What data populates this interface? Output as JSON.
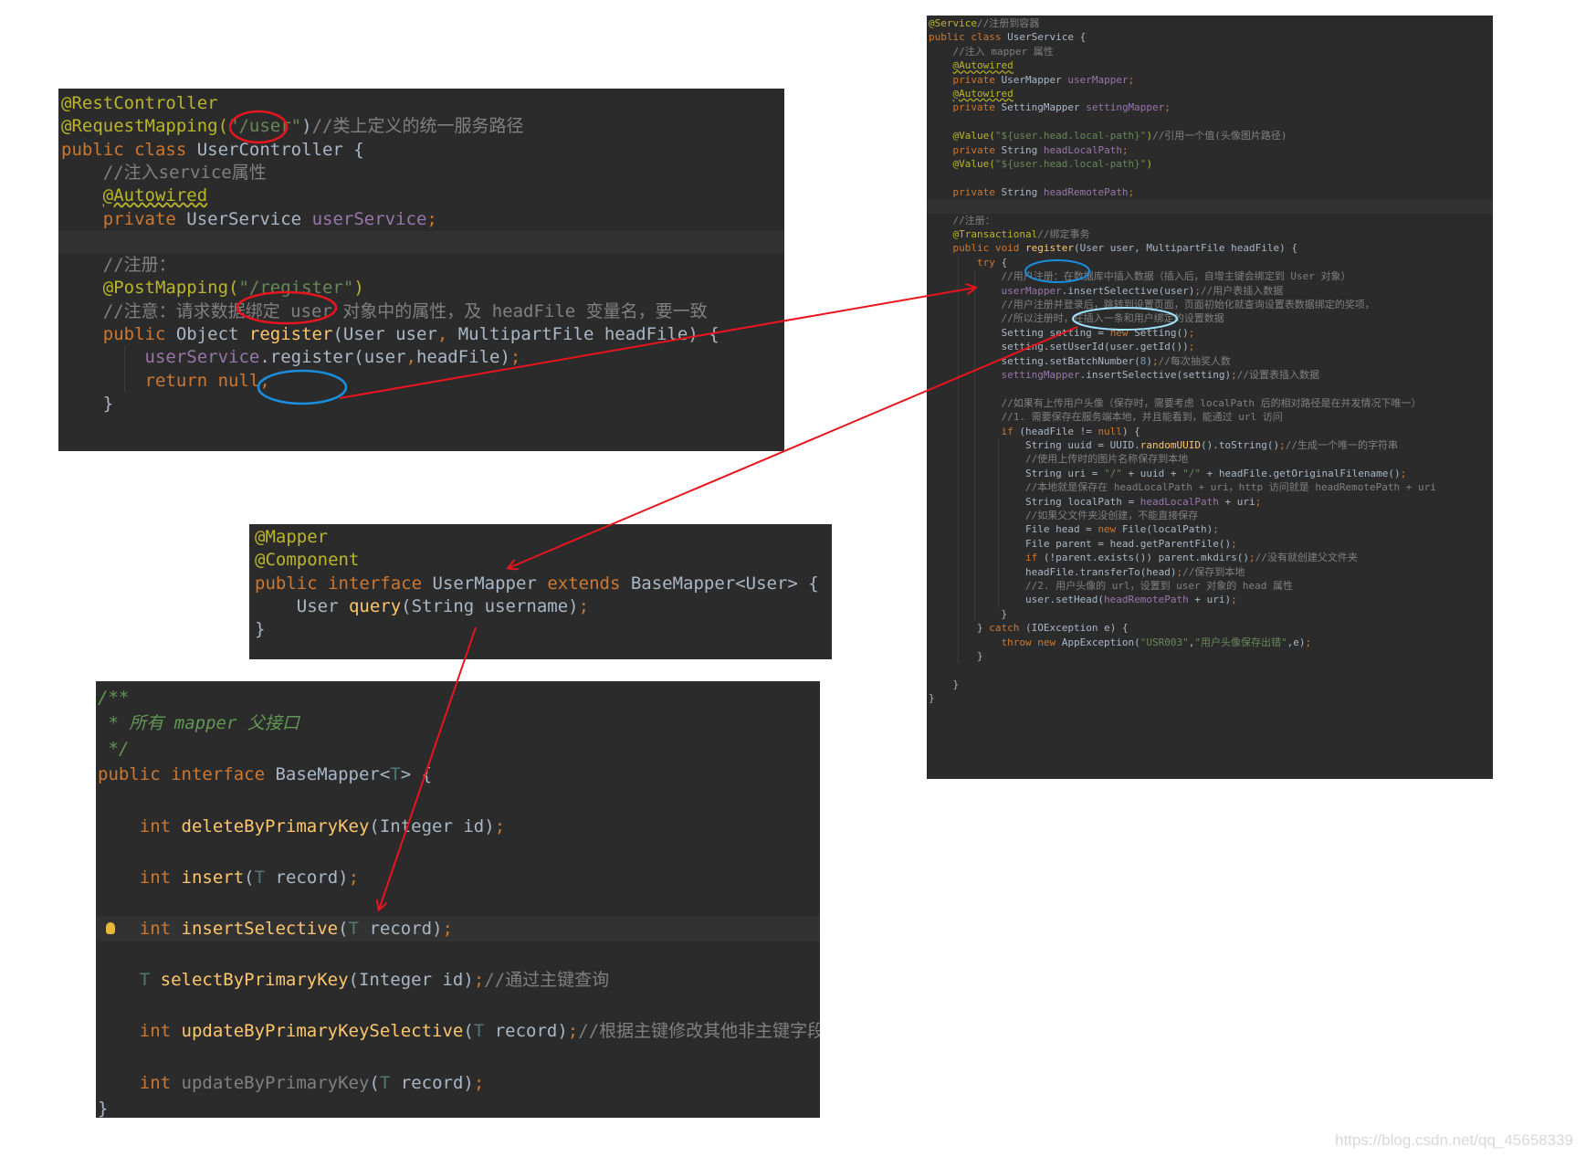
{
  "controller": {
    "lines": [
      [
        [
          "ann",
          "@RestController"
        ]
      ],
      [
        [
          "ann",
          "@RequestMapping("
        ],
        [
          "str",
          "\"/user\""
        ],
        [
          "tx",
          ")"
        ],
        [
          "cm",
          "//类上定义的统一服务路径"
        ]
      ],
      [
        [
          "kw",
          "public class "
        ],
        [
          "tx",
          "UserController {"
        ]
      ],
      [
        [
          "cm",
          "    //注入service属性"
        ]
      ],
      [
        [
          "tx",
          "    "
        ],
        [
          "ann ul",
          "@Autowired"
        ]
      ],
      [
        [
          "kw",
          "    private "
        ],
        [
          "tx",
          "UserService "
        ],
        [
          "fld",
          "userService"
        ],
        [
          "kw",
          ";"
        ]
      ],
      [
        [
          "tx",
          " "
        ]
      ],
      [
        [
          "cm",
          "    //注册："
        ]
      ],
      [
        [
          "ann",
          "    @PostMapping("
        ],
        [
          "str",
          "\"/register\""
        ],
        [
          "ann",
          ")"
        ]
      ],
      [
        [
          "cm",
          "    //注意：请求数据绑定 user 对象中的属性，及 headFile 变量名，要一致"
        ]
      ],
      [
        [
          "kw",
          "    public "
        ],
        [
          "tx",
          "Object "
        ],
        [
          "fn",
          "register"
        ],
        [
          "tx",
          "(User user"
        ],
        [
          "kw",
          ", "
        ],
        [
          "tx",
          "MultipartFile headFile) {"
        ]
      ],
      [
        [
          "fld",
          "        userService"
        ],
        [
          "tx",
          "."
        ],
        [
          "tx",
          "register(user"
        ],
        [
          "kw",
          ","
        ],
        [
          "tx",
          "headFile)"
        ],
        [
          "kw",
          ";"
        ]
      ],
      [
        [
          "kw",
          "        return null;"
        ]
      ],
      [
        [
          "tx",
          "    }"
        ]
      ]
    ]
  },
  "mapper": {
    "lines": [
      [
        [
          "ann",
          "@Mapper"
        ]
      ],
      [
        [
          "ann",
          "@Component"
        ]
      ],
      [
        [
          "kw",
          "public interface "
        ],
        [
          "tx",
          "UserMapper "
        ],
        [
          "kw",
          "extends "
        ],
        [
          "tx",
          "BaseMapper<User> {"
        ]
      ],
      [
        [
          "tx",
          "    User "
        ],
        [
          "fn",
          "query"
        ],
        [
          "tx",
          "(String username)"
        ],
        [
          "kw",
          ";"
        ]
      ],
      [
        [
          "tx",
          "}"
        ]
      ]
    ]
  },
  "basemapper": {
    "lines": [
      [
        [
          "doc",
          "/**"
        ]
      ],
      [
        [
          "doc",
          " * 所有 mapper 父接口"
        ]
      ],
      [
        [
          "doc",
          " */"
        ]
      ],
      [
        [
          "kw",
          "public interface "
        ],
        [
          "tx",
          "BaseMapper<"
        ],
        [
          "tp",
          "T"
        ],
        [
          "tx",
          "> {"
        ]
      ],
      [
        [
          "tx",
          " "
        ]
      ],
      [
        [
          "kw",
          "    int "
        ],
        [
          "fn",
          "deleteByPrimaryKey"
        ],
        [
          "tx",
          "(Integer id)"
        ],
        [
          "kw",
          ";"
        ]
      ],
      [
        [
          "tx",
          " "
        ]
      ],
      [
        [
          "kw",
          "    int "
        ],
        [
          "fn",
          "insert"
        ],
        [
          "tx",
          "("
        ],
        [
          "tp",
          "T "
        ],
        [
          "tx",
          "record)"
        ],
        [
          "kw",
          ";"
        ]
      ],
      [
        [
          "tx",
          " "
        ]
      ],
      [
        [
          "kw",
          "    int "
        ],
        [
          "fn",
          "insertSelective"
        ],
        [
          "tx",
          "("
        ],
        [
          "tp",
          "T "
        ],
        [
          "tx",
          "record)"
        ],
        [
          "kw",
          ";"
        ]
      ],
      [
        [
          "tx",
          " "
        ]
      ],
      [
        [
          "tp",
          "    T "
        ],
        [
          "fn",
          "selectByPrimaryKey"
        ],
        [
          "tx",
          "(Integer id)"
        ],
        [
          "kw",
          ";"
        ],
        [
          "cm",
          "//通过主键查询"
        ]
      ],
      [
        [
          "tx",
          " "
        ]
      ],
      [
        [
          "kw",
          "    int "
        ],
        [
          "fn",
          "updateByPrimaryKeySelective"
        ],
        [
          "tx",
          "("
        ],
        [
          "tp",
          "T "
        ],
        [
          "tx",
          "record)"
        ],
        [
          "kw",
          ";"
        ],
        [
          "cm",
          "//根据主键修改其他非主键字段"
        ]
      ],
      [
        [
          "tx",
          " "
        ]
      ],
      [
        [
          "kw",
          "    int "
        ],
        [
          "cm",
          "updateByPrimaryKey"
        ],
        [
          "tx",
          "("
        ],
        [
          "tp",
          "T "
        ],
        [
          "tx",
          "record)"
        ],
        [
          "kw",
          ";"
        ]
      ],
      [
        [
          "tx",
          "}"
        ]
      ]
    ]
  },
  "service": {
    "lines": [
      [
        [
          "ann",
          "@Service"
        ],
        [
          "cm",
          "//注册到容器"
        ]
      ],
      [
        [
          "kw",
          "public class "
        ],
        [
          "tx",
          "UserService {"
        ]
      ],
      [
        [
          "cm",
          "    //注入 mapper 属性"
        ]
      ],
      [
        [
          "tx",
          "    "
        ],
        [
          "ann ul",
          "@Autowired"
        ]
      ],
      [
        [
          "kw",
          "    private "
        ],
        [
          "tx",
          "UserMapper "
        ],
        [
          "fld",
          "userMapper"
        ],
        [
          "kw",
          ";"
        ]
      ],
      [
        [
          "tx",
          "    "
        ],
        [
          "ann ul",
          "@Autowired"
        ]
      ],
      [
        [
          "kw",
          "    private "
        ],
        [
          "tx",
          "SettingMapper "
        ],
        [
          "fld",
          "settingMapper"
        ],
        [
          "kw",
          ";"
        ]
      ],
      [
        [
          "tx",
          " "
        ]
      ],
      [
        [
          "ann",
          "    @Value("
        ],
        [
          "str",
          "\"${user.head.local-path}\""
        ],
        [
          "ann",
          ")"
        ],
        [
          "cm",
          "//引用一个值(头像图片路径)"
        ]
      ],
      [
        [
          "kw",
          "    private "
        ],
        [
          "tx",
          "String "
        ],
        [
          "fld",
          "headLocalPath"
        ],
        [
          "kw",
          ";"
        ]
      ],
      [
        [
          "ann",
          "    @Value("
        ],
        [
          "str",
          "\"${user.head.local-path}\""
        ],
        [
          "ann",
          ")"
        ]
      ],
      [
        [
          "tx",
          " "
        ]
      ],
      [
        [
          "kw",
          "    private "
        ],
        [
          "tx",
          "String "
        ],
        [
          "fld",
          "headRemotePath"
        ],
        [
          "kw",
          ";"
        ]
      ],
      [
        [
          "tx",
          " "
        ]
      ],
      [
        [
          "cm",
          "    //注册："
        ]
      ],
      [
        [
          "ann",
          "    @Transactional"
        ],
        [
          "cm",
          "//绑定事务"
        ]
      ],
      [
        [
          "kw",
          "    public void "
        ],
        [
          "fn",
          "register"
        ],
        [
          "tx",
          "(User user, MultipartFile headFile) {"
        ]
      ],
      [
        [
          "kw",
          "        try "
        ],
        [
          "tx",
          "{"
        ]
      ],
      [
        [
          "cm",
          "            //用户注册：在数据库中插入数据（插入后，自增主键会绑定到 User 对象）"
        ]
      ],
      [
        [
          "fld",
          "            userMapper"
        ],
        [
          "tx",
          ".insertSelective(user)"
        ],
        [
          "kw",
          ";"
        ],
        [
          "cm",
          "//用户表插入数据"
        ]
      ],
      [
        [
          "cm",
          "            //用户注册并登录后，跳转到设置页面，页面初始化就查询设置表数据绑定的奖项，"
        ]
      ],
      [
        [
          "cm",
          "            //所以注册时，在插入一条和用户绑定的设置数据"
        ]
      ],
      [
        [
          "tx",
          "            Setting setting = "
        ],
        [
          "kw",
          "new "
        ],
        [
          "tx",
          "Setting()"
        ],
        [
          "kw",
          ";"
        ]
      ],
      [
        [
          "tx",
          "            setting.setUserId(user.getId())"
        ],
        [
          "kw",
          ";"
        ]
      ],
      [
        [
          "tx",
          "            setting.setBatchNumber("
        ],
        [
          "num",
          "8"
        ],
        [
          "tx",
          ")"
        ],
        [
          "kw",
          ";"
        ],
        [
          "cm",
          "//每次抽奖人数"
        ]
      ],
      [
        [
          "fld",
          "            settingMapper"
        ],
        [
          "tx",
          ".insertSelective(setting)"
        ],
        [
          "kw",
          ";"
        ],
        [
          "cm",
          "//设置表插入数据"
        ]
      ],
      [
        [
          "tx",
          " "
        ]
      ],
      [
        [
          "cm",
          "            //如果有上传用户头像（保存时，需要考虑 localPath 后的相对路径是在并发情况下唯一）"
        ]
      ],
      [
        [
          "cm",
          "            //1. 需要保存在服务端本地，并且能看到，能通过 url 访问"
        ]
      ],
      [
        [
          "kw",
          "            if "
        ],
        [
          "tx",
          "(headFile != "
        ],
        [
          "kw",
          "null"
        ],
        [
          "tx",
          ") {"
        ]
      ],
      [
        [
          "tx",
          "                String uuid = UUID."
        ],
        [
          "fn",
          "randomUUID"
        ],
        [
          "tx",
          "().toString()"
        ],
        [
          "kw",
          ";"
        ],
        [
          "cm",
          "//生成一个唯一的字符串"
        ]
      ],
      [
        [
          "cm",
          "                //使用上传时的图片名称保存到本地"
        ]
      ],
      [
        [
          "tx",
          "                String uri = "
        ],
        [
          "str",
          "\"/\""
        ],
        [
          "tx",
          " + uuid + "
        ],
        [
          "str",
          "\"/\""
        ],
        [
          "tx",
          " + headFile.getOriginalFilename()"
        ],
        [
          "kw",
          ";"
        ]
      ],
      [
        [
          "cm",
          "                //本地就是保存在 headLocalPath + uri，http 访问就是 headRemotePath + uri"
        ]
      ],
      [
        [
          "tx",
          "                String localPath = "
        ],
        [
          "fld",
          "headLocalPath"
        ],
        [
          "tx",
          " + uri"
        ],
        [
          "kw",
          ";"
        ]
      ],
      [
        [
          "cm",
          "                //如果父文件夹没创建，不能直接保存"
        ]
      ],
      [
        [
          "tx",
          "                File head = "
        ],
        [
          "kw",
          "new "
        ],
        [
          "tx",
          "File(localPath)"
        ],
        [
          "kw",
          ";"
        ]
      ],
      [
        [
          "tx",
          "                File parent = head.getParentFile()"
        ],
        [
          "kw",
          ";"
        ]
      ],
      [
        [
          "kw",
          "                if "
        ],
        [
          "tx",
          "(!parent.exists()) parent.mkdirs()"
        ],
        [
          "kw",
          ";"
        ],
        [
          "cm",
          "//没有就创建父文件夹"
        ]
      ],
      [
        [
          "tx",
          "                headFile.transferTo(head)"
        ],
        [
          "kw",
          ";"
        ],
        [
          "cm",
          "//保存到本地"
        ]
      ],
      [
        [
          "cm",
          "                //2. 用户头像的 url，设置到 user 对象的 head 属性"
        ]
      ],
      [
        [
          "tx",
          "                user.setHead("
        ],
        [
          "fld",
          "headRemotePath"
        ],
        [
          "tx",
          " + uri)"
        ],
        [
          "kw",
          ";"
        ]
      ],
      [
        [
          "tx",
          "            }"
        ]
      ],
      [
        [
          "tx",
          "        } "
        ],
        [
          "kw",
          "catch "
        ],
        [
          "tx",
          "(IOException e) {"
        ]
      ],
      [
        [
          "kw",
          "            throw new "
        ],
        [
          "tx",
          "AppException("
        ],
        [
          "str",
          "\"USR003\""
        ],
        [
          "tx",
          ","
        ],
        [
          "str",
          "\"用户头像保存出错\""
        ],
        [
          "tx",
          ",e)"
        ],
        [
          "kw",
          ";"
        ]
      ],
      [
        [
          "tx",
          "        }"
        ]
      ],
      [
        [
          "tx",
          " "
        ]
      ],
      [
        [
          "tx",
          "    }"
        ]
      ],
      [
        [
          "tx",
          "}"
        ]
      ]
    ]
  },
  "watermark": "https://blog.csdn.net/qq_45658339",
  "colors": {
    "panel_bg": "#2b2b2b",
    "arrow": "#e8141e",
    "circle_red": "#e8141e",
    "circle_blue": "#1a8fe0"
  }
}
